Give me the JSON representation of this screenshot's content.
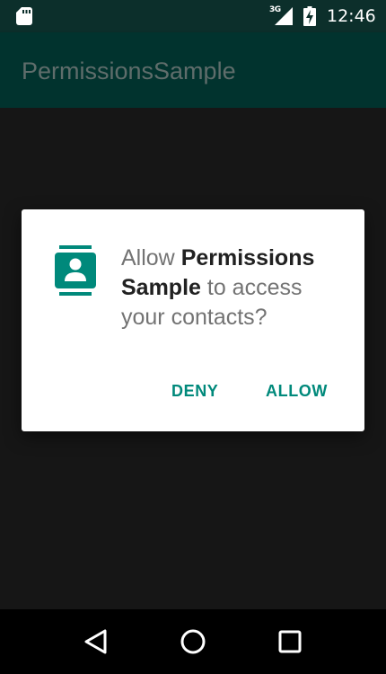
{
  "status_bar": {
    "network_type": "3G",
    "time": "12:46",
    "icons": [
      "sd-card-icon",
      "signal-icon",
      "battery-charging-icon"
    ]
  },
  "app_bar": {
    "title": "PermissionsSample"
  },
  "dialog": {
    "icon": "contacts-icon",
    "message_prefix": "Allow ",
    "app_name": "Permissions Sample",
    "message_suffix": " to access your contacts?",
    "deny_label": "DENY",
    "allow_label": "ALLOW"
  },
  "nav_bar": {
    "buttons": [
      "back-icon",
      "home-icon",
      "recents-icon"
    ]
  },
  "colors": {
    "accent": "#00897b",
    "status_bar": "#0c2f2b",
    "app_bar_dimmed": "#01332e",
    "scrim": "#161616",
    "nav_bar": "#000000"
  }
}
